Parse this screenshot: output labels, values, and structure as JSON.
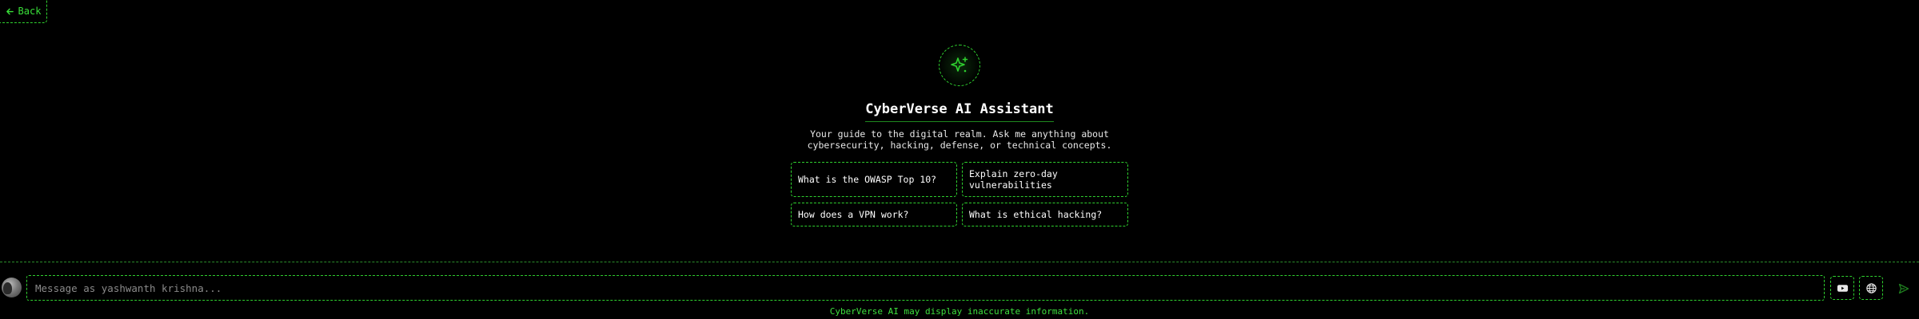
{
  "nav": {
    "back_label": "Back"
  },
  "hero": {
    "title": "CyberVerse AI Assistant",
    "subtitle": "Your guide to the digital realm. Ask me anything about cybersecurity, hacking, defense, or technical concepts.",
    "logo_icon": "sparkles-icon"
  },
  "suggestions": [
    {
      "label": "What is the OWASP Top 10?"
    },
    {
      "label": "Explain zero-day vulnerabilities"
    },
    {
      "label": "How does a VPN work?"
    },
    {
      "label": "What is ethical hacking?"
    }
  ],
  "composer": {
    "placeholder": "Message as yashwanth krishna...",
    "value": "",
    "tools": [
      "youtube-icon",
      "globe-icon"
    ],
    "send_icon": "send-icon"
  },
  "footer": {
    "disclaimer": "CyberVerse AI may display inaccurate information."
  },
  "colors": {
    "accent": "#2fd12f",
    "background": "#000000",
    "text": "#ffffff"
  }
}
